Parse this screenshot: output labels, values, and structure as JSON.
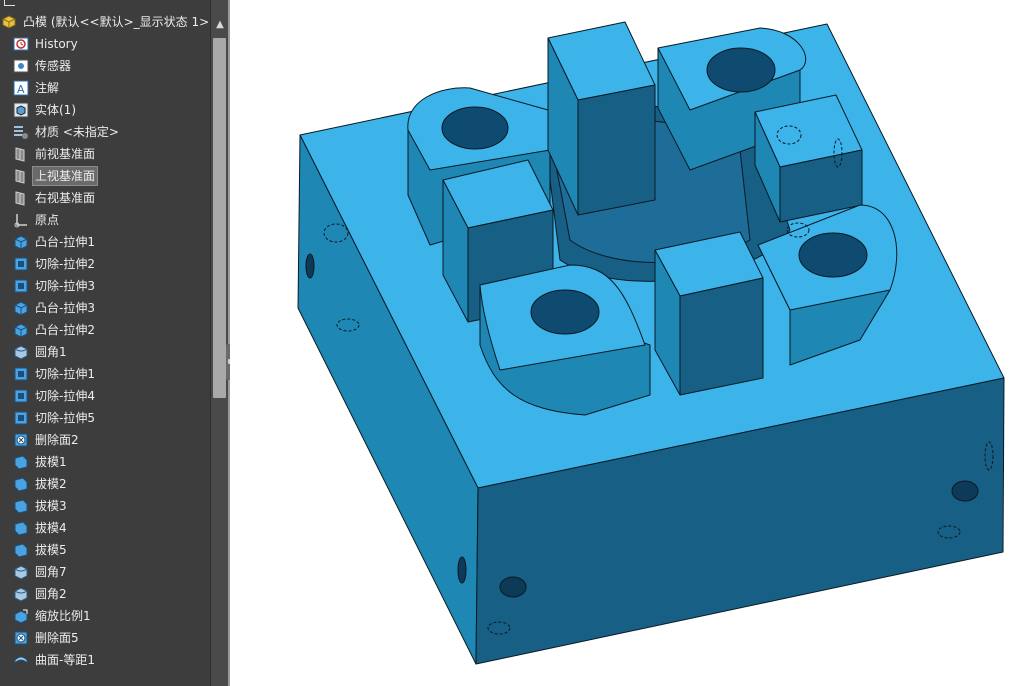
{
  "feature_tree": {
    "root_label": "凸模  (默认<<默认>_显示状态 1>)",
    "items": [
      {
        "label": "History",
        "icon": "history-icon"
      },
      {
        "label": "传感器",
        "icon": "sensor-icon"
      },
      {
        "label": "注解",
        "icon": "annotation-icon"
      },
      {
        "label": "实体(1)",
        "icon": "solid-bodies-icon"
      },
      {
        "label": "材质 <未指定>",
        "icon": "material-icon"
      },
      {
        "label": "前视基准面",
        "icon": "plane-icon"
      },
      {
        "label": "上视基准面",
        "icon": "plane-icon",
        "selected": true
      },
      {
        "label": "右视基准面",
        "icon": "plane-icon"
      },
      {
        "label": "原点",
        "icon": "origin-icon"
      },
      {
        "label": "凸台-拉伸1",
        "icon": "boss-extrude-icon"
      },
      {
        "label": "切除-拉伸2",
        "icon": "cut-extrude-icon"
      },
      {
        "label": "切除-拉伸3",
        "icon": "cut-extrude-icon"
      },
      {
        "label": "凸台-拉伸3",
        "icon": "boss-extrude-icon"
      },
      {
        "label": "凸台-拉伸2",
        "icon": "boss-extrude-icon"
      },
      {
        "label": "圆角1",
        "icon": "fillet-icon"
      },
      {
        "label": "切除-拉伸1",
        "icon": "cut-extrude-icon"
      },
      {
        "label": "切除-拉伸4",
        "icon": "cut-extrude-icon"
      },
      {
        "label": "切除-拉伸5",
        "icon": "cut-extrude-icon"
      },
      {
        "label": "删除面2",
        "icon": "delete-face-icon"
      },
      {
        "label": "拔模1",
        "icon": "draft-icon"
      },
      {
        "label": "拔模2",
        "icon": "draft-icon"
      },
      {
        "label": "拔模3",
        "icon": "draft-icon"
      },
      {
        "label": "拔模4",
        "icon": "draft-icon"
      },
      {
        "label": "拔模5",
        "icon": "draft-icon"
      },
      {
        "label": "圆角7",
        "icon": "fillet-icon"
      },
      {
        "label": "圆角2",
        "icon": "fillet-icon"
      },
      {
        "label": "缩放比例1",
        "icon": "scale-icon"
      },
      {
        "label": "删除面5",
        "icon": "delete-face-icon"
      },
      {
        "label": "曲面-等距1",
        "icon": "offset-surface-icon"
      }
    ]
  },
  "colors": {
    "panel_bg": "#3d3d3d",
    "panel_text": "#ececec",
    "model_top": "#3cb4ea",
    "model_side": "#1f87b4",
    "model_front": "#175f84",
    "model_dark": "#0d3a57",
    "edge": "#0a1a24"
  }
}
